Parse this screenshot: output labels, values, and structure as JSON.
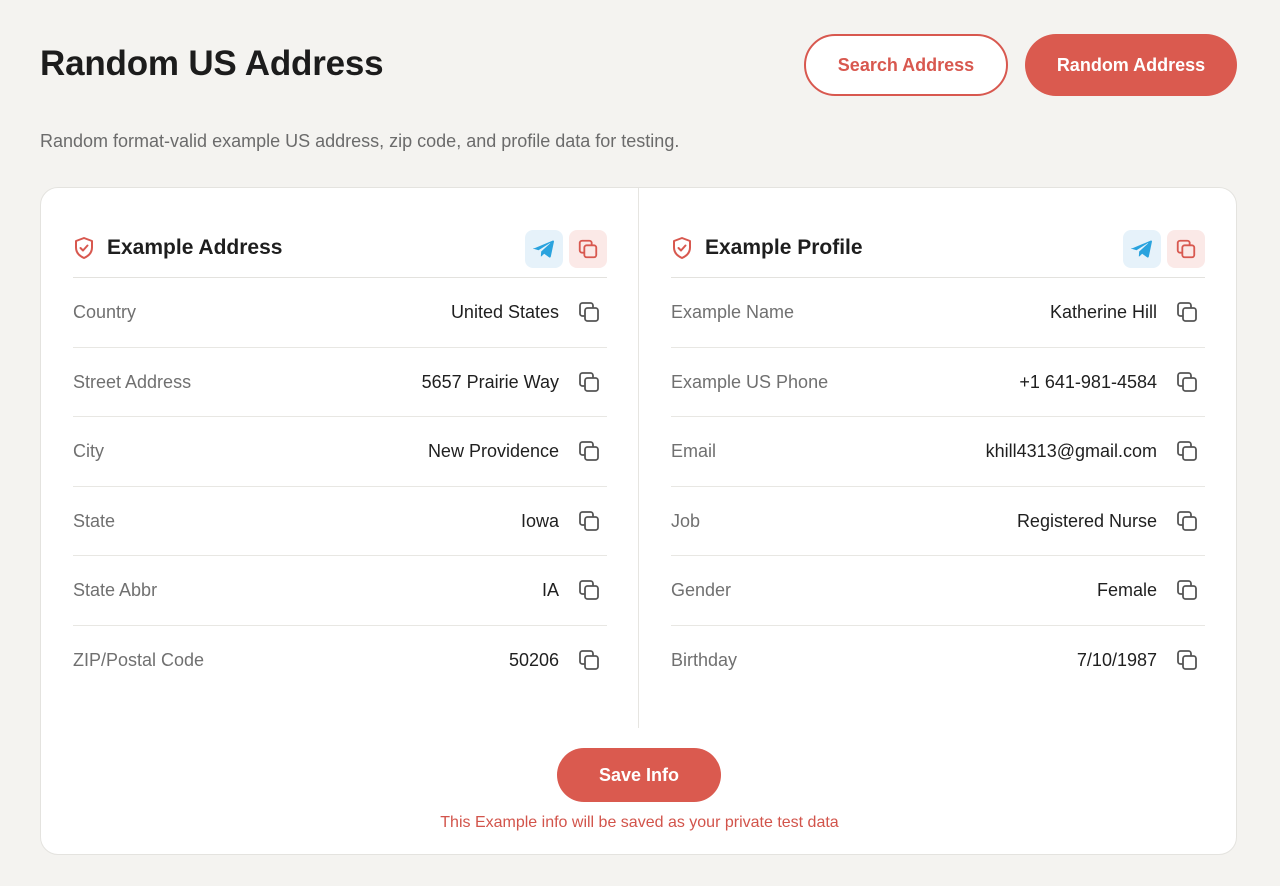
{
  "header": {
    "title": "Random US Address",
    "search_label": "Search Address",
    "random_label": "Random Address"
  },
  "subtitle": "Random format-valid example US address, zip code, and profile data for testing.",
  "colors": {
    "accent": "#da5a4f",
    "background": "#f4f3f0",
    "telegram_blue": "#2aa3de"
  },
  "address": {
    "title": "Example Address",
    "rows": [
      {
        "label": "Country",
        "value": "United States"
      },
      {
        "label": "Street Address",
        "value": "5657 Prairie Way"
      },
      {
        "label": "City",
        "value": "New Providence"
      },
      {
        "label": "State",
        "value": "Iowa"
      },
      {
        "label": "State Abbr",
        "value": "IA"
      },
      {
        "label": "ZIP/Postal Code",
        "value": "50206"
      }
    ]
  },
  "profile": {
    "title": "Example Profile",
    "rows": [
      {
        "label": "Example Name",
        "value": "Katherine Hill"
      },
      {
        "label": "Example US Phone",
        "value": "+1 641-981-4584"
      },
      {
        "label": "Email",
        "value": "khill4313@gmail.com"
      },
      {
        "label": "Job",
        "value": "Registered Nurse"
      },
      {
        "label": "Gender",
        "value": "Female"
      },
      {
        "label": "Birthday",
        "value": "7/10/1987"
      }
    ]
  },
  "footer": {
    "save_label": "Save Info",
    "note": "This Example info will be saved as your private test data"
  },
  "icons": {
    "panel": "shield-check-icon",
    "share": "telegram-icon",
    "copy": "copy-icon"
  }
}
